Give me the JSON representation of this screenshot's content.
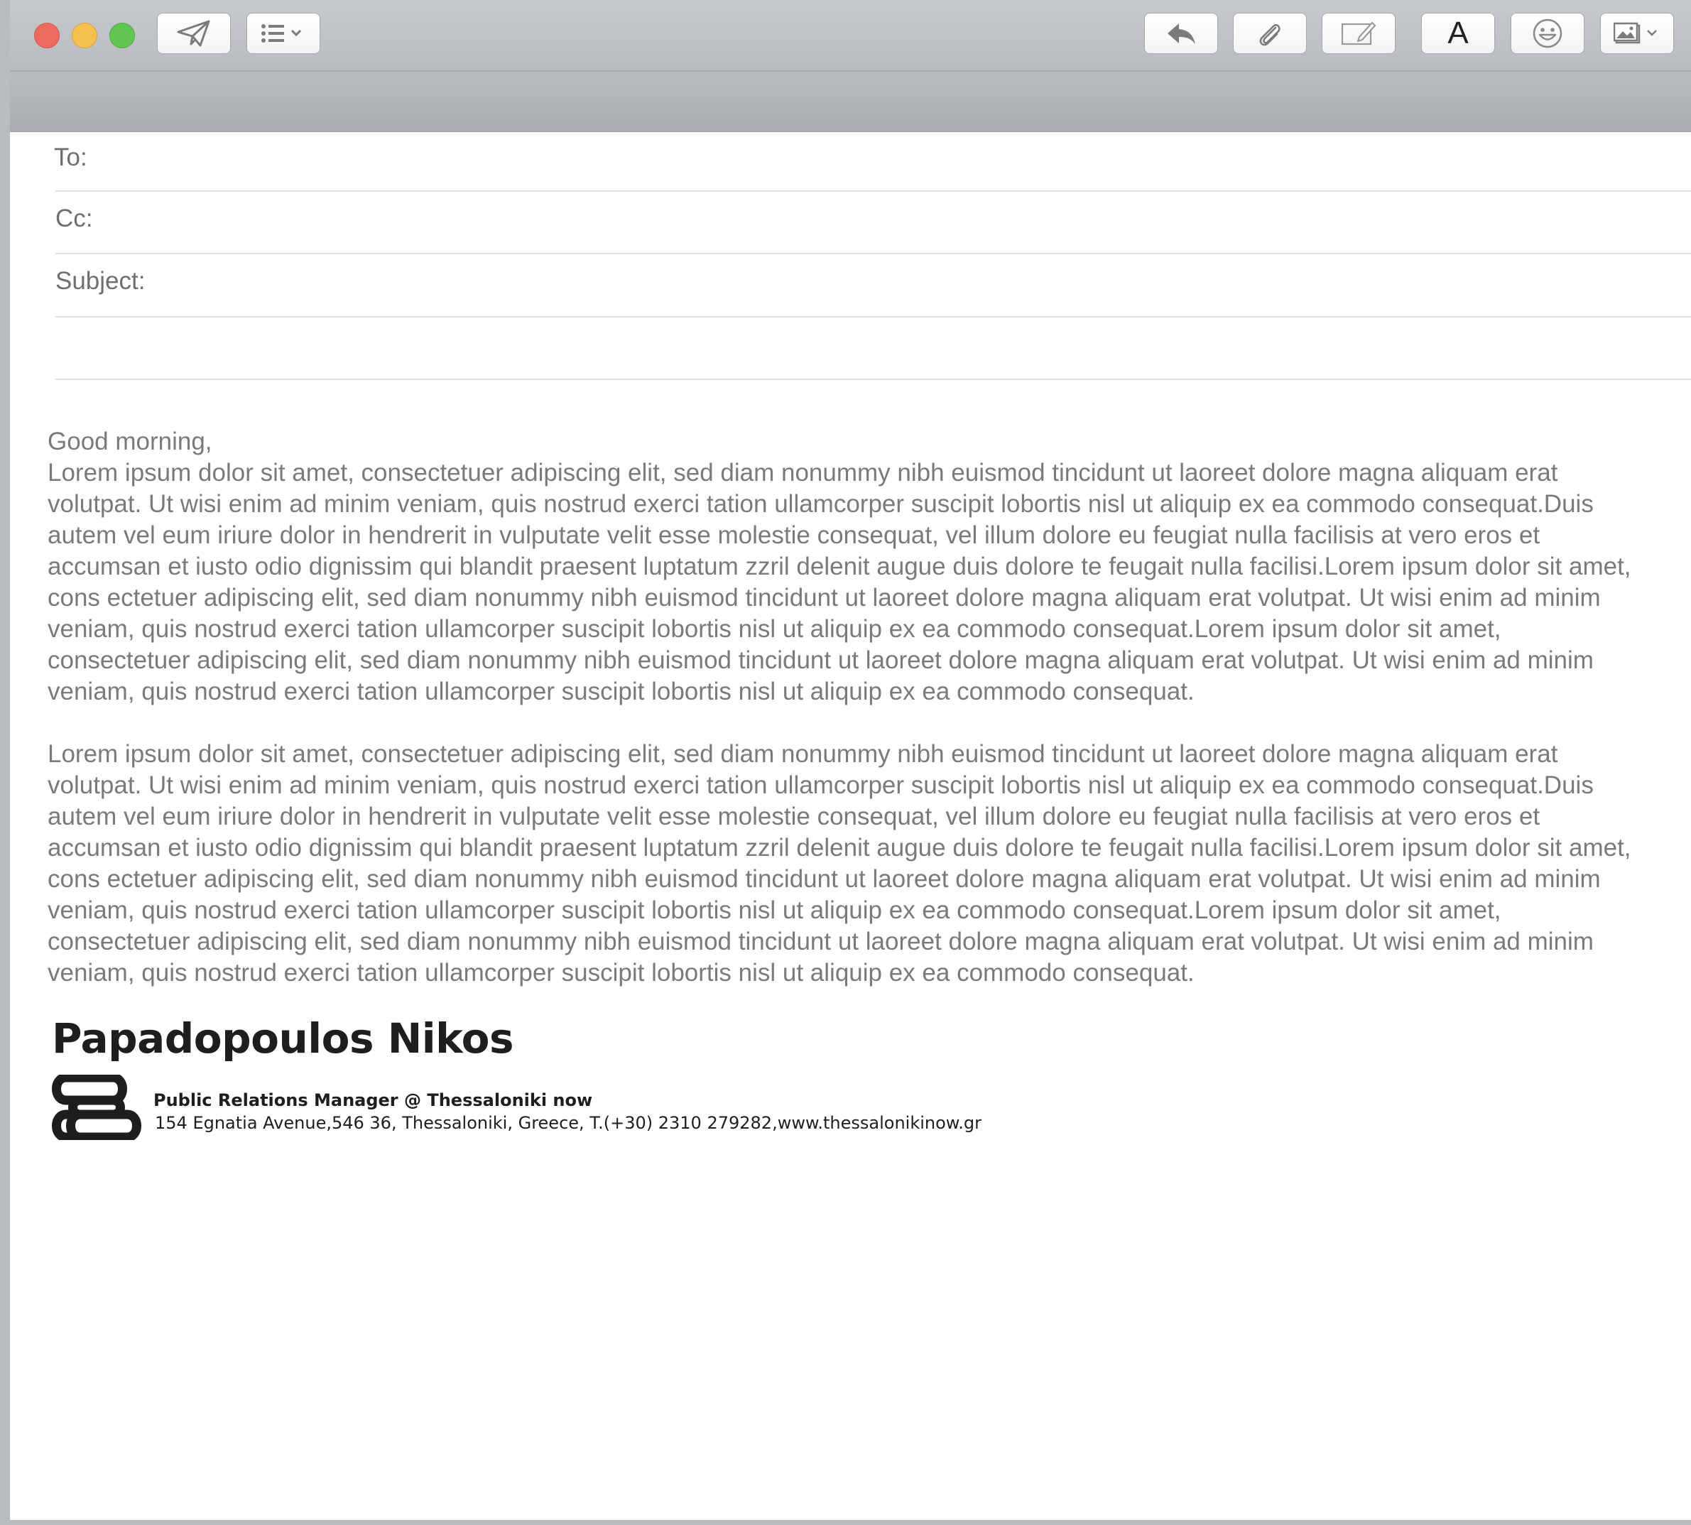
{
  "toolbar": {
    "send_icon": "paper-plane-icon",
    "list_icon": "list-icon",
    "reply_icon": "reply-arrow-icon",
    "attach_icon": "paperclip-icon",
    "markup_icon": "markup-pencil-icon",
    "font_label": "A",
    "emoji_icon": "smiley-icon",
    "photo_icon": "photo-browser-icon"
  },
  "headers": {
    "to_label": "To:",
    "cc_label": "Cc:",
    "subject_label": "Subject:"
  },
  "body": {
    "greeting": "Good morning,",
    "paragraph1": "Lorem ipsum dolor sit amet, consectetuer adipiscing elit, sed diam nonummy nibh euismod tincidunt ut laoreet dolore magna aliquam erat volutpat. Ut wisi enim ad minim veniam, quis nostrud exerci tation ullamcorper suscipit lobortis nisl ut aliquip ex ea commodo consequat.Duis autem vel eum iriure dolor in hendrerit in vulputate velit esse molestie consequat, vel illum dolore eu feugiat nulla facilisis at vero eros et accumsan et iusto odio dignissim qui blandit praesent luptatum zzril delenit augue duis dolore te feugait nulla facilisi.Lorem ipsum dolor sit amet, cons ectetuer adipiscing elit, sed diam nonummy nibh euismod tincidunt ut laoreet dolore magna aliquam erat volutpat. Ut wisi enim ad minim veniam, quis nostrud exerci tation ullamcorper suscipit lobortis nisl ut aliquip ex ea commodo consequat.Lorem ipsum dolor sit amet, consectetuer adipiscing elit, sed diam nonummy nibh euismod tincidunt ut laoreet dolore magna aliquam erat volutpat. Ut wisi enim ad minim veniam, quis nostrud exerci tation ullamcorper suscipit lobortis nisl ut aliquip ex ea commodo consequat.",
    "paragraph2": "Lorem ipsum dolor sit amet, consectetuer adipiscing elit, sed diam nonummy nibh euismod tincidunt ut laoreet dolore magna aliquam erat volutpat. Ut wisi enim ad minim veniam, quis nostrud exerci tation ullamcorper suscipit lobortis nisl ut aliquip ex ea commodo consequat.Duis autem vel eum iriure dolor in hendrerit in vulputate velit esse molestie consequat, vel illum dolore eu feugiat nulla facilisis at vero eros et accumsan et iusto odio dignissim qui blandit praesent luptatum zzril delenit augue duis dolore te feugait nulla facilisi.Lorem ipsum dolor sit amet, cons ectetuer adipiscing elit, sed diam nonummy nibh euismod tincidunt ut laoreet dolore magna aliquam erat volutpat. Ut wisi enim ad minim veniam, quis nostrud exerci tation ullamcorper suscipit lobortis nisl ut aliquip ex ea commodo consequat.Lorem ipsum dolor sit amet, consectetuer adipiscing elit, sed diam nonummy nibh euismod tincidunt ut laoreet dolore magna aliquam erat volutpat. Ut wisi enim ad minim veniam, quis nostrud exerci tation ullamcorper suscipit lobortis nisl ut aliquip ex ea commodo consequat."
  },
  "signature": {
    "name": "Papadopoulos Nikos",
    "role": "Public Relations Manager @ Thessaloniki now",
    "address": "154 Egnatia Avenue,546 36, Thessaloniki, Greece, T.(+30) 2310 279282,www.thessalonikinow.gr",
    "logo_icon": "thessaloniki-now-logo"
  },
  "colors": {
    "close": "#ed6a5e",
    "minimize": "#f5bf4f",
    "maximize": "#61c554",
    "body_text": "#7a7a7a",
    "signature_text": "#1e1e1e"
  }
}
